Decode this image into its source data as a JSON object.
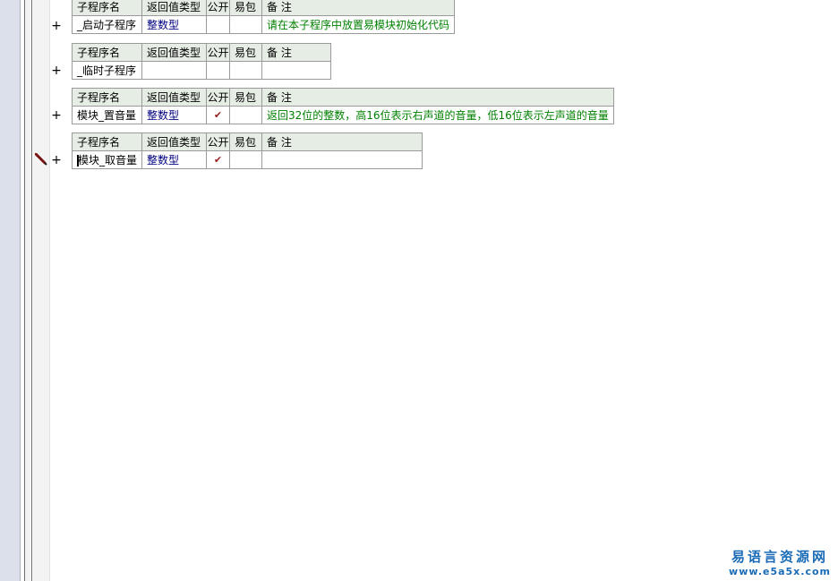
{
  "columns": {
    "name": "子程序名",
    "return_type": "返回值类型",
    "public": "公开",
    "package": "易包",
    "note": "备 注"
  },
  "subprograms": [
    {
      "name": "_启动子程序",
      "return_type": "整数型",
      "public": "",
      "package": "",
      "note": "请在本子程序中放置易模块初始化代码",
      "expand": "+"
    },
    {
      "name": "_临时子程序",
      "return_type": "",
      "public": "",
      "package": "",
      "note": "",
      "expand": "+"
    },
    {
      "name": "模块_置音量",
      "return_type": "整数型",
      "public": "✔",
      "package": "",
      "note": "返回32位的整数，高16位表示右声道的音量，低16位表示左声道的音量",
      "expand": "+"
    },
    {
      "name": "模块_取音量",
      "return_type": "整数型",
      "public": "✔",
      "package": "",
      "note": "",
      "expand": "+"
    }
  ],
  "watermark": {
    "line1": "易语言资源网",
    "line2": "www.e5a5x.com"
  },
  "icons": {
    "edit_marker": "pencil-icon",
    "expand": "plus-icon"
  },
  "colors": {
    "header_bg": "#e6ede5",
    "type_text": "#000080",
    "note_text": "#008000",
    "check": "#9a1f1f"
  }
}
